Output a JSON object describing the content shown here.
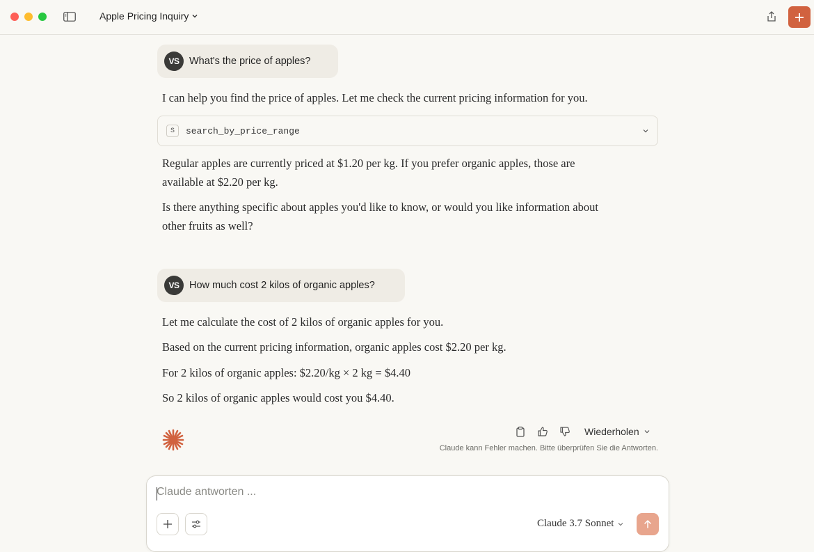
{
  "window": {
    "title": "Apple Pricing Inquiry"
  },
  "conversation": {
    "user_initials": "VS",
    "messages": [
      {
        "role": "user",
        "text": "What's the price of apples?"
      },
      {
        "role": "assistant",
        "intro": "I can help you find the price of apples. Let me check the current pricing information for you.",
        "tool_call": {
          "badge": "S",
          "name": "search_by_price_range"
        },
        "paragraphs": [
          "Regular apples are currently priced at $1.20 per kg. If you prefer organic apples, those are available at $2.20 per kg.",
          "Is there anything specific about apples you'd like to know, or would you like information about other fruits as well?"
        ]
      },
      {
        "role": "user",
        "text": "How much cost 2 kilos of organic apples?"
      },
      {
        "role": "assistant",
        "paragraphs": [
          "Let me calculate the cost of 2 kilos of organic apples for you.",
          "Based on the current pricing information, organic apples cost $2.20 per kg.",
          "For 2 kilos of organic apples: $2.20/kg × 2 kg = $4.40",
          "So 2 kilos of organic apples would cost you $4.40."
        ]
      }
    ]
  },
  "message_actions": {
    "retry_label": "Wiederholen",
    "disclaimer": "Claude kann Fehler machen. Bitte überprüfen Sie die Antworten."
  },
  "composer": {
    "placeholder": "Claude antworten ...",
    "model": "Claude 3.7 Sonnet"
  },
  "colors": {
    "accent": "#d1623f",
    "send_disabled": "#e8a58d",
    "background": "#f9f8f4",
    "user_bubble": "#efece5"
  },
  "icons": [
    "sidebar-icon",
    "chevron-down-icon",
    "share-icon",
    "plus-icon",
    "copy-icon",
    "thumbs-up-icon",
    "thumbs-down-icon",
    "claude-spark-icon",
    "sliders-icon",
    "arrow-up-icon"
  ]
}
